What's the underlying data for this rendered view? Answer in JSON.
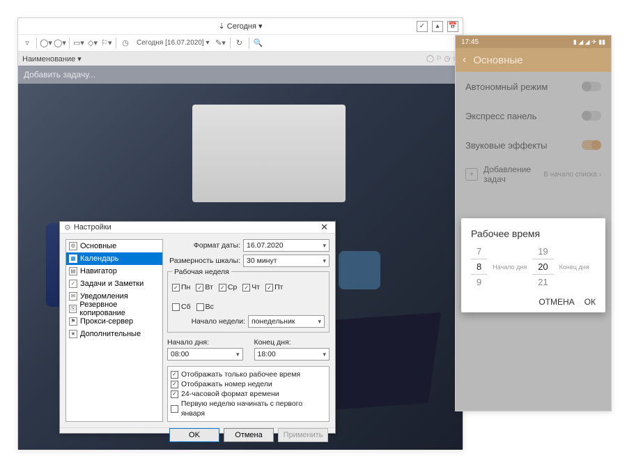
{
  "desktop": {
    "today_label": "⇣ Сегодня ▾",
    "toolbar_date": "Сегодня [16.07.2020] ▾",
    "header_col": "Наименование ▾",
    "add_task": "Добавить задачу..."
  },
  "settings": {
    "title": "Настройки",
    "nav": [
      "Основные",
      "Календарь",
      "Навигатор",
      "Задачи и Заметки",
      "Уведомления",
      "Резервное копирование",
      "Прокси-сервер",
      "Дополнительные"
    ],
    "date_format_lbl": "Формат даты:",
    "date_format_val": "16.07.2020",
    "scale_lbl": "Размерность шкалы:",
    "scale_val": "30 минут",
    "workweek_title": "Рабочая неделя",
    "days": [
      {
        "lbl": "Пн",
        "on": true
      },
      {
        "lbl": "Вт",
        "on": true
      },
      {
        "lbl": "Ср",
        "on": true
      },
      {
        "lbl": "Чт",
        "on": true
      },
      {
        "lbl": "Пт",
        "on": true
      },
      {
        "lbl": "Сб",
        "on": false
      },
      {
        "lbl": "Вс",
        "on": false
      }
    ],
    "week_start_lbl": "Начало недели:",
    "week_start_val": "понедельник",
    "day_start_lbl": "Начало дня:",
    "day_start_val": "08:00",
    "day_end_lbl": "Конец дня:",
    "day_end_val": "18:00",
    "opts": [
      {
        "lbl": "Отображать только рабочее время",
        "on": true
      },
      {
        "lbl": "Отображать номер недели",
        "on": true
      },
      {
        "lbl": "24-часовой формат времени",
        "on": true
      },
      {
        "lbl": "Первую неделю начинать с первого января",
        "on": false
      }
    ],
    "ok": "OK",
    "cancel": "Отмена",
    "apply": "Применить"
  },
  "phone": {
    "time": "17:45",
    "header": "Основные",
    "rows": [
      {
        "lbl": "Автономный режим",
        "on": false
      },
      {
        "lbl": "Экспресс панель",
        "on": false
      },
      {
        "lbl": "Звуковые эффекты",
        "on": true
      }
    ],
    "add_lbl": "Добавление задач",
    "add_val": "В начало списка",
    "dialog": {
      "title": "Рабочее время",
      "start": {
        "prev": "7",
        "val": "8",
        "next": "9",
        "lbl": "Начало дня"
      },
      "end": {
        "prev": "19",
        "val": "20",
        "next": "21",
        "lbl": "Конец дня"
      },
      "cancel": "ОТМЕНА",
      "ok": "ОК"
    }
  }
}
